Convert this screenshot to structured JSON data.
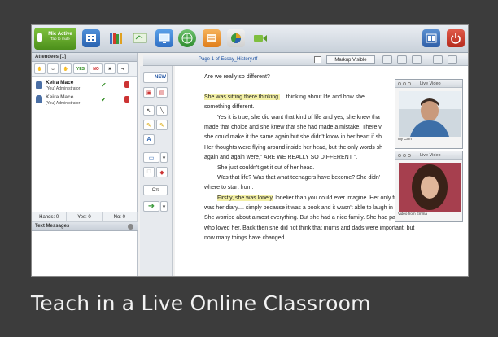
{
  "toolbar": {
    "mic": {
      "title": "Mic Active",
      "subtitle": "Tap to mute"
    },
    "color_accent": "#4c8f1b"
  },
  "attendees": {
    "header": "Attendees [1]",
    "status_buttons": [
      "YES",
      "NO"
    ],
    "items": [
      {
        "name": "Keira Mace",
        "role": "(You) Administrator"
      },
      {
        "name": "Keira Mace",
        "role": "(You) Administrator"
      }
    ]
  },
  "counts": {
    "hands": "Hands: 0",
    "yes": "Yes: 0",
    "no": "No: 0"
  },
  "text_messages": {
    "header": "Text Messages"
  },
  "document": {
    "page_label": "Page 1 of Essay_History.rtf",
    "markup_label": "Markup Visible",
    "new_label": "NEW",
    "lines": [
      "Are we really so different?",
      "",
      "She was sitting there thinking.... thinking about life and how she",
      "something different.",
      "Yes it is true, she did want that kind of life and yes, she knew tha",
      "made that choice and she knew that she had made a mistake. There v",
      "she could make it the same again but she didn't know in her heart if sh",
      "Her thoughts were flying around inside her head, but the only words sh",
      "again and again were,\" ARE WE REALLY SO DIFFERENT \".",
      "She just couldn't get it out of her head.",
      "Was that life? Was that what teenagers have become? She didn'",
      "where to start from.",
      "Firstly, she was lonely, lonelier than you could ever imagine. Her only friend",
      "was her diary.... simply because it was a book and it wasn't able to laugh in her face",
      "She worried about almost everything. But she had a nice family. She had parents",
      "who loved her. Back then she did not think that mums and dads were important, but",
      "now many things have changed."
    ]
  },
  "videos": [
    {
      "title": "Live Video",
      "caption": "My Cam"
    },
    {
      "title": "Live Video",
      "caption": "Video from Emma"
    }
  ],
  "caption": "Teach in a Live Online Classroom"
}
